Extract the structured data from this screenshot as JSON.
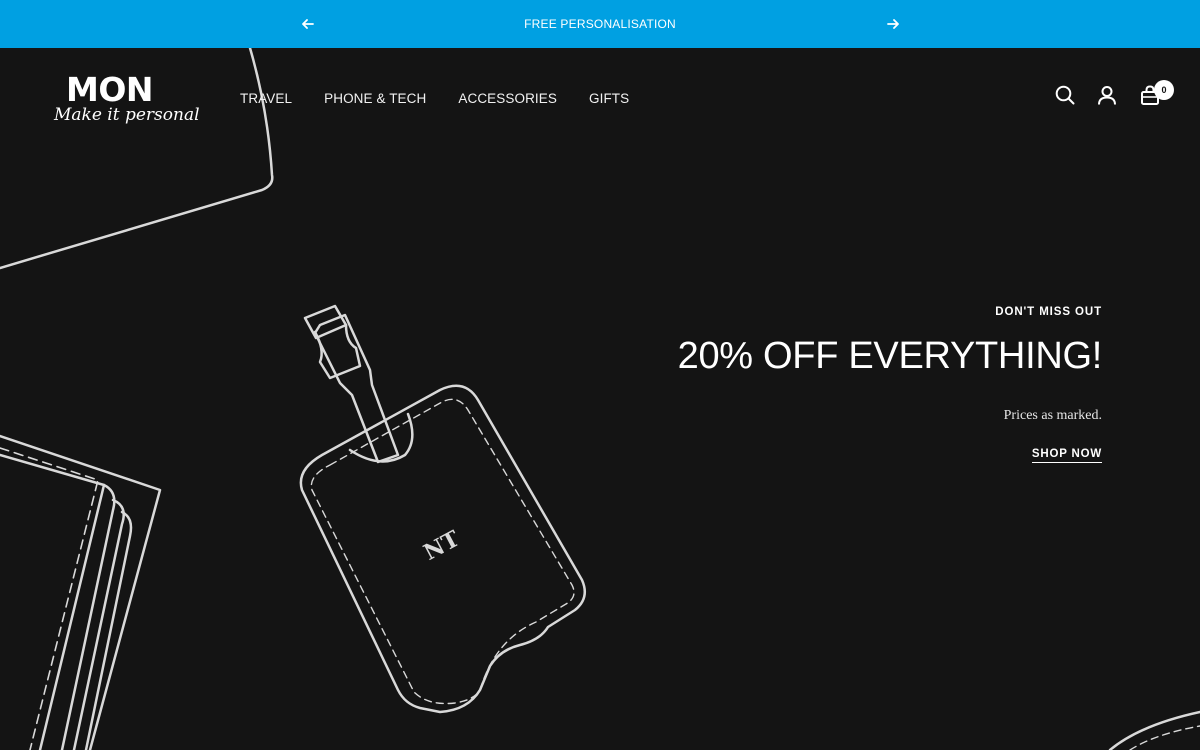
{
  "announcement": {
    "message": "FREE PERSONALISATION",
    "prev_icon": "arrow-left-icon",
    "next_icon": "arrow-right-icon",
    "background": "#00a0e2"
  },
  "logo": {
    "wordmark": "MON",
    "tagline": "Make it personal"
  },
  "nav": {
    "items": [
      "TRAVEL",
      "PHONE & TECH",
      "ACCESSORIES",
      "GIFTS"
    ]
  },
  "header_icons": {
    "search": "search-icon",
    "account": "account-icon",
    "cart": "cart-icon",
    "cart_count": "0"
  },
  "hero": {
    "eyebrow": "DON'T MISS OUT",
    "headline": "20% OFF EVERYTHING!",
    "subtext": "Prices as marked.",
    "cta": "SHOP NOW",
    "tag_monogram": "NT",
    "background": "#141414",
    "line_color": "#d9d9d9"
  }
}
